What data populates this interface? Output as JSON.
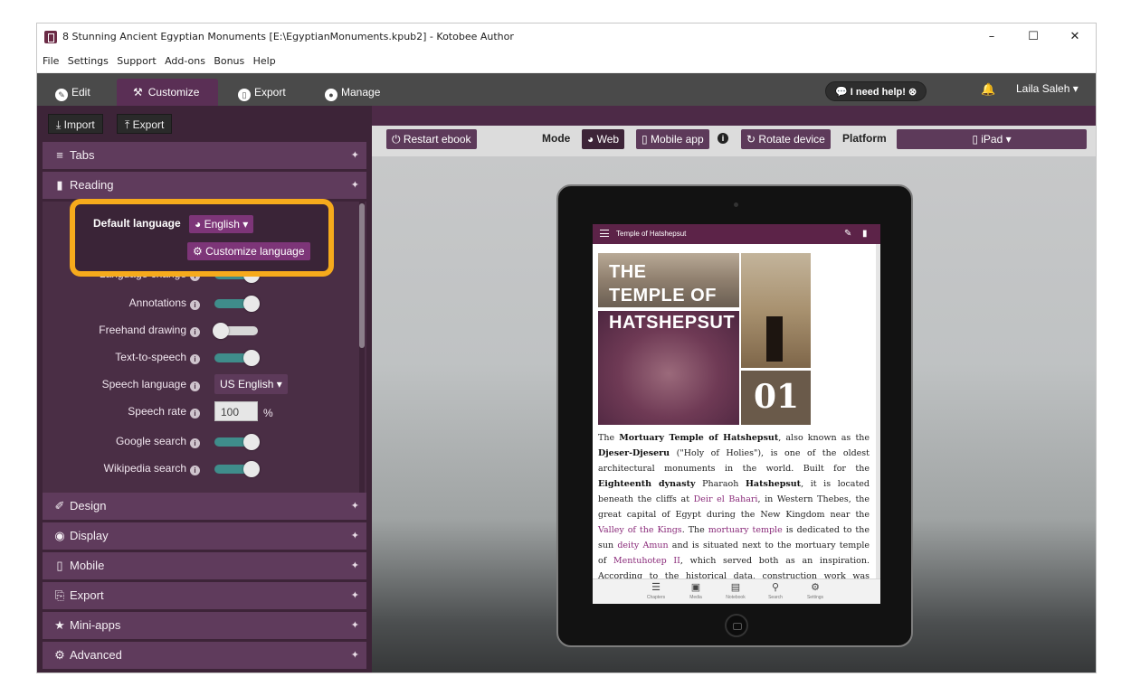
{
  "window": {
    "title": "8 Stunning Ancient Egyptian Monuments [E:\\EgyptianMonuments.kpub2] - Kotobee Author",
    "controls": {
      "minimize": "–",
      "maximize": "☐",
      "close": "✕"
    }
  },
  "menu": [
    "File",
    "Settings",
    "Support",
    "Add-ons",
    "Bonus",
    "Help"
  ],
  "tabs": [
    {
      "label": "Edit",
      "icon": "pencil-icon"
    },
    {
      "label": "Customize",
      "icon": "wrench-icon",
      "active": true
    },
    {
      "label": "Export",
      "icon": "device-icon"
    },
    {
      "label": "Manage",
      "icon": "user-icon"
    }
  ],
  "header": {
    "help": "I need help!",
    "user": "Laila Saleh"
  },
  "left": {
    "import_label": "Import",
    "export_label": "Export",
    "sections": {
      "tabs": "Tabs",
      "reading": "Reading",
      "design": "Design",
      "display": "Display",
      "mobile": "Mobile",
      "export": "Export",
      "miniapps": "Mini-apps",
      "advanced": "Advanced"
    },
    "reading": {
      "default_language_label": "Default language",
      "language_value": "English",
      "customize_language": "Customize language",
      "language_change": "Language change",
      "annotations": "Annotations",
      "freehand": "Freehand drawing",
      "tts": "Text-to-speech",
      "speech_language_label": "Speech language",
      "speech_language_value": "US English",
      "speech_rate_label": "Speech rate",
      "speech_rate_value": "100",
      "speech_rate_unit": "%",
      "google_search": "Google search",
      "wikipedia_search": "Wikipedia search"
    }
  },
  "preview": {
    "restart": "Restart ebook",
    "mode_label": "Mode",
    "web": "Web",
    "mobile_app": "Mobile app",
    "rotate": "Rotate device",
    "platform_label": "Platform",
    "platform_value": "iPad"
  },
  "ebook": {
    "chapter_title": "Temple of Hatshepsut",
    "cover_line1": "THE",
    "cover_line2": "TEMPLE OF",
    "cover_line3": "HATSHEPSUT",
    "chapter_number": "01",
    "bottom_nav": [
      "Chapters",
      "Media",
      "Notebook",
      "Search",
      "Settings"
    ]
  },
  "colors": {
    "accent": "#5f3b5c",
    "highlight": "#f6aa1c",
    "toggle_on": "#3f8d8b",
    "link": "#8a2b7a"
  }
}
